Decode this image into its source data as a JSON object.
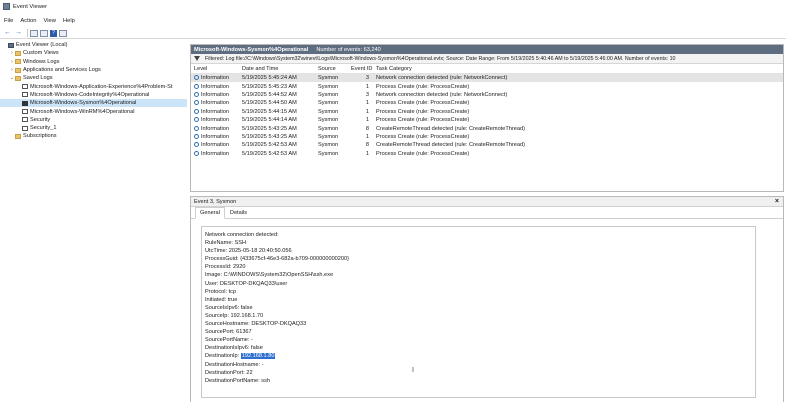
{
  "window": {
    "title": "Event Viewer"
  },
  "menu": [
    "File",
    "Action",
    "View",
    "Help"
  ],
  "tree": [
    {
      "label": "Event Viewer (Local)",
      "level": 0,
      "icon": "computer-icon",
      "exp": ""
    },
    {
      "label": "Custom Views",
      "level": 1,
      "icon": "folder-icon",
      "exp": "›"
    },
    {
      "label": "Windows Logs",
      "level": 1,
      "icon": "folder-icon",
      "exp": "›"
    },
    {
      "label": "Applications and Services Logs",
      "level": 1,
      "icon": "folder-icon",
      "exp": "›"
    },
    {
      "label": "Saved Logs",
      "level": 1,
      "icon": "folder-icon",
      "exp": "⌄"
    },
    {
      "label": "Microsoft-Windows-Application-Experience%4Problem-St",
      "level": 2,
      "icon": "log-icon",
      "exp": ""
    },
    {
      "label": "Microsoft-Windows-CodeIntegrity%4Operational",
      "level": 2,
      "icon": "log-icon",
      "exp": ""
    },
    {
      "label": "Microsoft-Windows-Sysmon%4Operational",
      "level": 2,
      "icon": "log-icon",
      "exp": "",
      "selected": true
    },
    {
      "label": "Microsoft-Windows-WinRM%4Operational",
      "level": 2,
      "icon": "log-icon",
      "exp": ""
    },
    {
      "label": "Security",
      "level": 2,
      "icon": "log-icon",
      "exp": ""
    },
    {
      "label": "Security_1",
      "level": 2,
      "icon": "log-icon",
      "exp": ""
    },
    {
      "label": "Subscriptions",
      "level": 1,
      "icon": "folder-icon",
      "exp": ""
    }
  ],
  "log": {
    "name": "Microsoft-Windows-Sysmon%4Operational",
    "count_label": "Number of events: 63,240",
    "filter": "Filtered: Log file://C:\\Windows\\System32\\winevt\\Logs\\Microsoft-Windows-Sysmon%4Operational.evtx; Source: Date Range: From 5/19/2025 5:40:46 AM to 5/19/2025 5:46:00 AM. Number of events: 10",
    "columns": [
      "Level",
      "Date and Time",
      "Source",
      "Event ID",
      "Task Category"
    ],
    "rows": [
      [
        "Information",
        "5/19/2025 5:45:24 AM",
        "Sysmon",
        "3",
        "Network connection detected (rule: NetworkConnect)"
      ],
      [
        "Information",
        "5/19/2025 5:45:23 AM",
        "Sysmon",
        "1",
        "Process Create (rule: ProcessCreate)"
      ],
      [
        "Information",
        "5/19/2025 5:44:52 AM",
        "Sysmon",
        "3",
        "Network connection detected (rule: NetworkConnect)"
      ],
      [
        "Information",
        "5/19/2025 5:44:50 AM",
        "Sysmon",
        "1",
        "Process Create (rule: ProcessCreate)"
      ],
      [
        "Information",
        "5/19/2025 5:44:15 AM",
        "Sysmon",
        "1",
        "Process Create (rule: ProcessCreate)"
      ],
      [
        "Information",
        "5/19/2025 5:44:14 AM",
        "Sysmon",
        "1",
        "Process Create (rule: ProcessCreate)"
      ],
      [
        "Information",
        "5/19/2025 5:43:25 AM",
        "Sysmon",
        "8",
        "CreateRemoteThread detected (rule: CreateRemoteThread)"
      ],
      [
        "Information",
        "5/19/2025 5:43:25 AM",
        "Sysmon",
        "1",
        "Process Create (rule: ProcessCreate)"
      ],
      [
        "Information",
        "5/19/2025 5:42:53 AM",
        "Sysmon",
        "8",
        "CreateRemoteThread detected (rule: CreateRemoteThread)"
      ],
      [
        "Information",
        "5/19/2025 5:42:53 AM",
        "Sysmon",
        "1",
        "Process Create (rule: ProcessCreate)"
      ]
    ]
  },
  "detail": {
    "title": "Event 3, Sysmon",
    "tabs": [
      "General",
      "Details"
    ],
    "lines": [
      "Network connection detected:",
      "RuleName: SSH",
      "UtcTime: 2025-05-18 20:40:50.056",
      "ProcessGuid: {433675cf-46e3-682a-b709-000000000200}",
      "ProcessId: 2920",
      "Image: C:\\WINDOWS\\System32\\OpenSSH\\ssh.exe",
      "User: DESKTOP-DKQAQ33\\user",
      "Protocol: tcp",
      "Initiated: true",
      "SourceIsIpv6: false",
      "SourceIp: 192.168.1.70",
      "SourceHostname: DESKTOP-DKQAQ33",
      "SourcePort: 61367",
      "SourcePortName: -",
      "DestinationIsIpv6: false",
      "DestinationIp: ",
      "DestinationHostname: -",
      "DestinationPort: 22",
      "DestinationPortName: ssh"
    ],
    "highlight": "192.168.1.80"
  },
  "colors": {
    "header_bg": "#5f6d80",
    "selection": "#cce4f7",
    "highlight": "#2f6fd1"
  }
}
